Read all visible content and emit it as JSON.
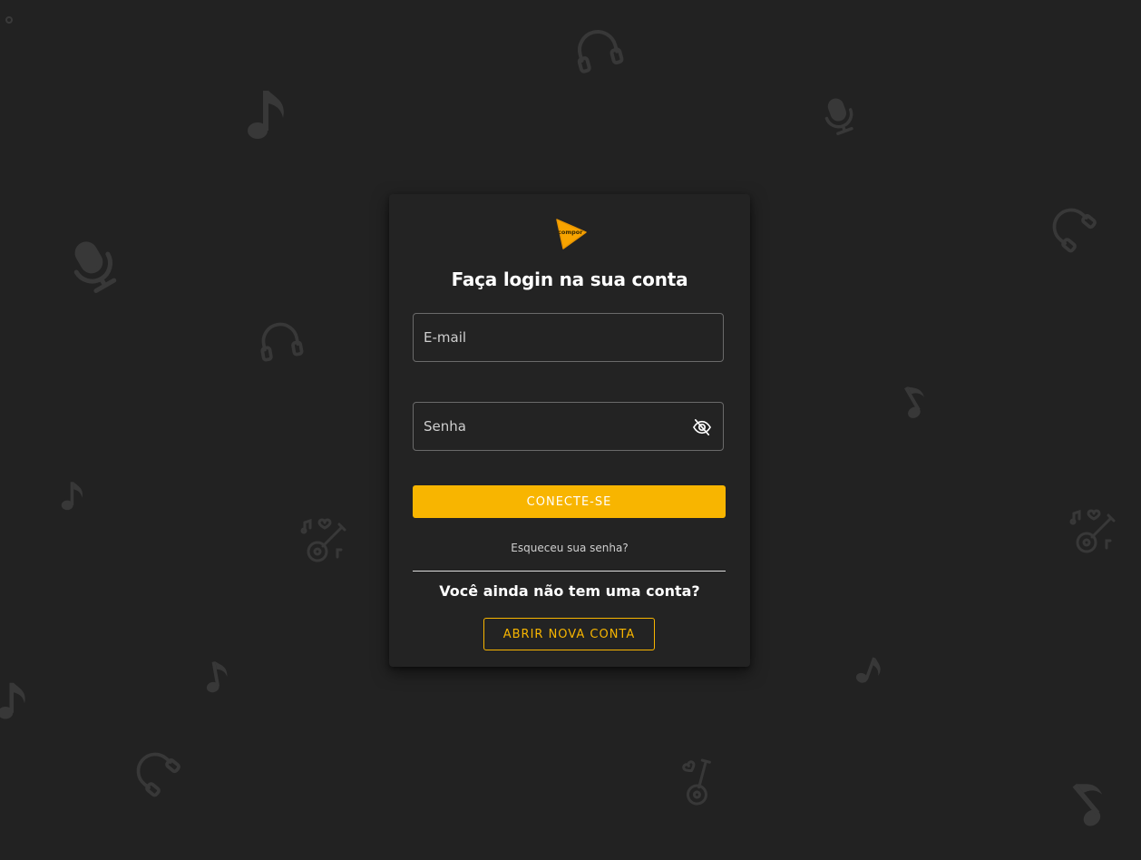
{
  "theme": {
    "background": "#222222",
    "card": "#232323",
    "accent": "#F8B500",
    "decor": "#3A3A3A"
  },
  "brand": {
    "logo_text": "compor",
    "logo_icon": "play-triangle-logo"
  },
  "login": {
    "title": "Faça login na sua conta",
    "email_placeholder": "E-mail",
    "email_value": "",
    "password_placeholder": "Senha",
    "password_value": "",
    "password_toggle_icon": "eye-off-icon",
    "submit_label": "CONECTE-SE",
    "forgot_label": "Esqueceu sua senha?"
  },
  "signup": {
    "prompt": "Você ainda não tem uma conta?",
    "button_label": "ABRIR NOVA CONTA"
  },
  "background_icons": [
    "headphones-icon",
    "music-note-icon",
    "microphone-icon",
    "guitar-icon"
  ]
}
